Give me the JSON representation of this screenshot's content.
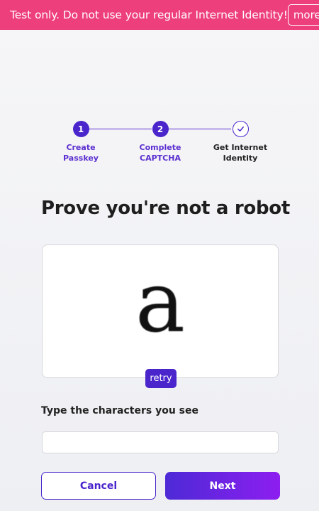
{
  "banner": {
    "text": "Test only. Do not use your regular Internet Identity!",
    "more_label": "more",
    "color": "#ee3f7d"
  },
  "stepper": {
    "steps": [
      {
        "number": "1",
        "label_line1": "Create",
        "label_line2": "Passkey",
        "state": "completed"
      },
      {
        "number": "2",
        "label_line1": "Complete",
        "label_line2": "CAPTCHA",
        "state": "current"
      },
      {
        "icon": "checkmark-icon",
        "label_line1": "Get Internet",
        "label_line2": "Identity",
        "state": "pending"
      }
    ]
  },
  "main": {
    "title": "Prove you're not a robot",
    "captcha": {
      "characters": "a",
      "retry_label": "retry"
    },
    "input_label": "Type the characters you see",
    "input_value": "",
    "input_placeholder": ""
  },
  "actions": {
    "cancel_label": "Cancel",
    "next_label": "Next"
  },
  "colors": {
    "accent": "#4a25cc",
    "banner": "#ee3f7d"
  }
}
